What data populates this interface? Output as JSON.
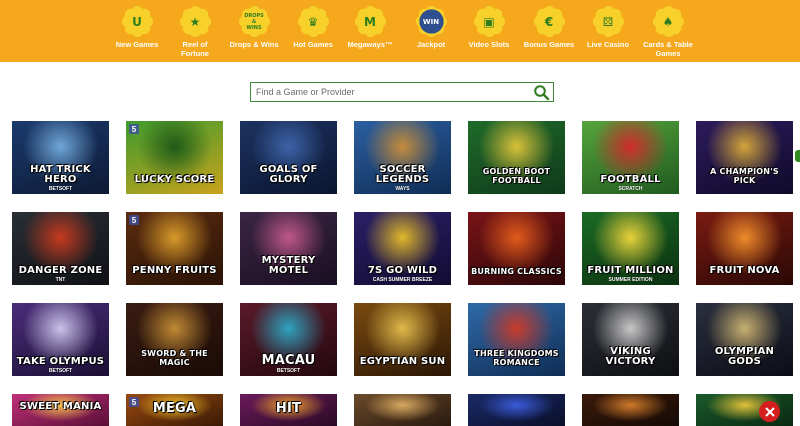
{
  "nav": {
    "items": [
      {
        "label": "New Games",
        "glyph": "U",
        "icon": "new-games-icon"
      },
      {
        "label": "Reel of Fortune",
        "glyph": "★",
        "icon": "reel-of-fortune-icon"
      },
      {
        "label": "Drops & Wins",
        "glyph": "DROPS & WINS",
        "icon": "drops-wins-icon"
      },
      {
        "label": "Hot Games",
        "glyph": "♛",
        "icon": "hot-games-icon"
      },
      {
        "label": "Megaways™",
        "glyph": "M",
        "icon": "megaways-icon"
      },
      {
        "label": "Jackpot",
        "glyph": "WIN",
        "icon": "jackpot-icon"
      },
      {
        "label": "Video Slots",
        "glyph": "▣",
        "icon": "video-slots-icon"
      },
      {
        "label": "Bonus Games",
        "glyph": "€",
        "icon": "bonus-games-icon"
      },
      {
        "label": "Live Casino",
        "glyph": "⚄",
        "icon": "live-casino-icon"
      },
      {
        "label": "Cards & Table Games",
        "glyph": "♠",
        "icon": "cards-table-icon"
      }
    ]
  },
  "search": {
    "placeholder": "Find a Game or Provider"
  },
  "games": [
    {
      "title": "Hat Trick Hero",
      "sub": "BETSOFT",
      "badge": ""
    },
    {
      "title": "Lucky Score",
      "sub": "",
      "badge": "5"
    },
    {
      "title": "Goals of Glory",
      "sub": "",
      "badge": ""
    },
    {
      "title": "Soccer Legends",
      "sub": "WAYS",
      "badge": ""
    },
    {
      "title": "Golden Boot Football",
      "sub": "",
      "badge": ""
    },
    {
      "title": "Football",
      "sub": "SCRATCH",
      "badge": ""
    },
    {
      "title": "A Champion's Pick",
      "sub": "",
      "badge": ""
    },
    {
      "title": "Danger Zone",
      "sub": "TNT",
      "badge": ""
    },
    {
      "title": "Penny Fruits",
      "sub": "",
      "badge": "5"
    },
    {
      "title": "Mystery Motel",
      "sub": "",
      "badge": ""
    },
    {
      "title": "7s Go Wild",
      "sub": "CASH SUMMER BREEZE",
      "badge": ""
    },
    {
      "title": "Burning Classics",
      "sub": "",
      "badge": ""
    },
    {
      "title": "Fruit Million",
      "sub": "SUMMER EDITION",
      "badge": ""
    },
    {
      "title": "Fruit Nova",
      "sub": "",
      "badge": ""
    },
    {
      "title": "Take Olympus",
      "sub": "BETSOFT",
      "badge": ""
    },
    {
      "title": "Sword & the Magic",
      "sub": "",
      "badge": ""
    },
    {
      "title": "Macau",
      "sub": "BETSOFT",
      "badge": ""
    },
    {
      "title": "Egyptian Sun",
      "sub": "",
      "badge": ""
    },
    {
      "title": "Three Kingdoms Romance",
      "sub": "",
      "badge": ""
    },
    {
      "title": "Viking Victory",
      "sub": "",
      "badge": ""
    },
    {
      "title": "Olympian Gods",
      "sub": "",
      "badge": ""
    },
    {
      "title": "Sweet Mania",
      "sub": "",
      "badge": ""
    },
    {
      "title": "Mega",
      "sub": "",
      "badge": "5"
    },
    {
      "title": "Hit",
      "sub": "",
      "badge": ""
    },
    {
      "title": "",
      "sub": "",
      "badge": ""
    },
    {
      "title": "",
      "sub": "",
      "badge": ""
    },
    {
      "title": "",
      "sub": "",
      "badge": ""
    },
    {
      "title": "",
      "sub": "",
      "badge": ""
    }
  ],
  "colors": {
    "header": "#f6a81c",
    "badge_fill": "#f7d02a",
    "badge_green": "#2f7d1f",
    "search_border": "#3e8a3a",
    "close": "#d51f1f"
  }
}
